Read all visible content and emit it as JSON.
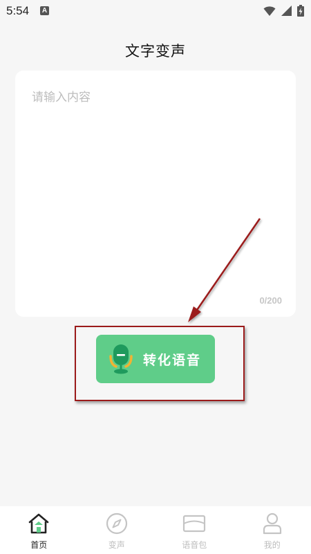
{
  "status_bar": {
    "time": "5:54",
    "notification_icon": "A",
    "icons": [
      "wifi-icon",
      "signal-icon",
      "battery-charging-icon"
    ]
  },
  "page": {
    "title": "文字变声"
  },
  "editor": {
    "placeholder": "请输入内容",
    "value": "",
    "counter": "0/200"
  },
  "convert_button": {
    "label": "转化语音",
    "icon": "microphone-icon",
    "color": "#5fcd89"
  },
  "annotation": {
    "color": "#9b1b1b"
  },
  "bottom_nav": {
    "items": [
      {
        "label": "首页",
        "icon": "home-icon",
        "active": true
      },
      {
        "label": "变声",
        "icon": "compass-icon",
        "active": false
      },
      {
        "label": "语音包",
        "icon": "envelope-icon",
        "active": false
      },
      {
        "label": "我的",
        "icon": "user-icon",
        "active": false
      }
    ],
    "active_color": "#222222",
    "inactive_color": "#bdbdbd",
    "accent": "#5fcd89"
  }
}
